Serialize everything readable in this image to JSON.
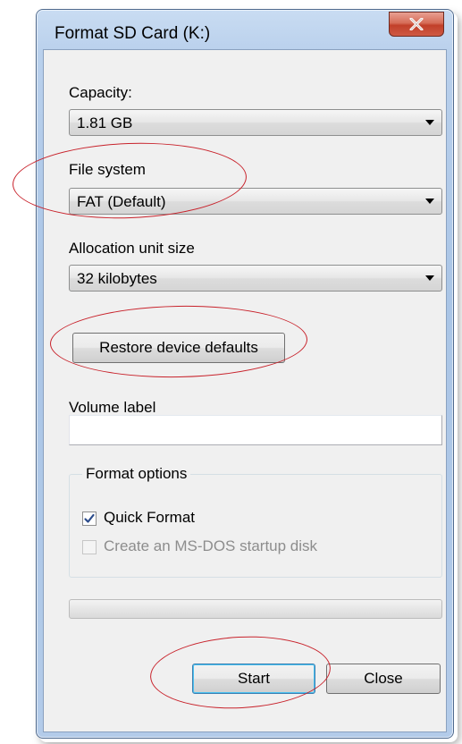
{
  "window": {
    "title": "Format SD Card (K:)",
    "close_icon": "close-x-icon"
  },
  "capacity": {
    "label": "Capacity:",
    "value": "1.81 GB"
  },
  "file_system": {
    "label": "File system",
    "value": "FAT (Default)"
  },
  "allocation": {
    "label": "Allocation unit size",
    "value": "32 kilobytes"
  },
  "restore_button_label": "Restore device defaults",
  "volume_label": {
    "label": "Volume label",
    "value": ""
  },
  "format_options": {
    "title": "Format options",
    "quick_format": {
      "label": "Quick Format",
      "checked": true,
      "enabled": true
    },
    "ms_dos": {
      "label": "Create an MS-DOS startup disk",
      "checked": false,
      "enabled": false
    }
  },
  "progress": {
    "fraction": 0
  },
  "buttons": {
    "start": "Start",
    "close": "Close"
  },
  "colors": {
    "annotation": "#c8222b",
    "window_frame": "#b9d0ec",
    "client_bg": "#f0f0f0",
    "close_button": "#c1402a"
  }
}
